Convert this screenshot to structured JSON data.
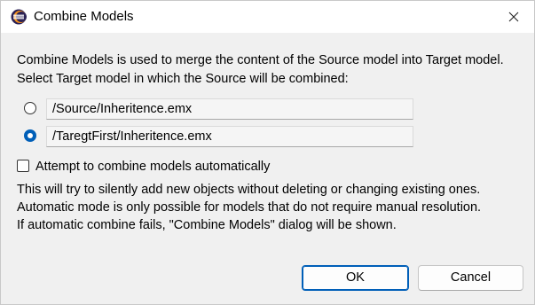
{
  "window": {
    "title": "Combine Models",
    "app_icon": "eclipse-icon",
    "close_icon": "close-icon"
  },
  "description": {
    "line1": "Combine Models is used to merge the content of the Source model into Target model.",
    "line2": "Select Target model in which the Source will be combined:"
  },
  "targets": [
    {
      "path": "/Source/Inheritence.emx",
      "selected": false
    },
    {
      "path": "/TaregtFirst/Inheritence.emx",
      "selected": true
    }
  ],
  "auto_combine": {
    "label": "Attempt to combine models automatically",
    "checked": false
  },
  "auto_info": {
    "line1": "This will try to silently add new objects without deleting or changing existing ones.",
    "line2": "Automatic mode is only possible for models that do not require manual resolution.",
    "line3": "If automatic combine fails, \"Combine Models\" dialog will be shown."
  },
  "buttons": {
    "ok": "OK",
    "cancel": "Cancel"
  },
  "colors": {
    "accent": "#005fb8",
    "background": "#f0f0f0"
  }
}
